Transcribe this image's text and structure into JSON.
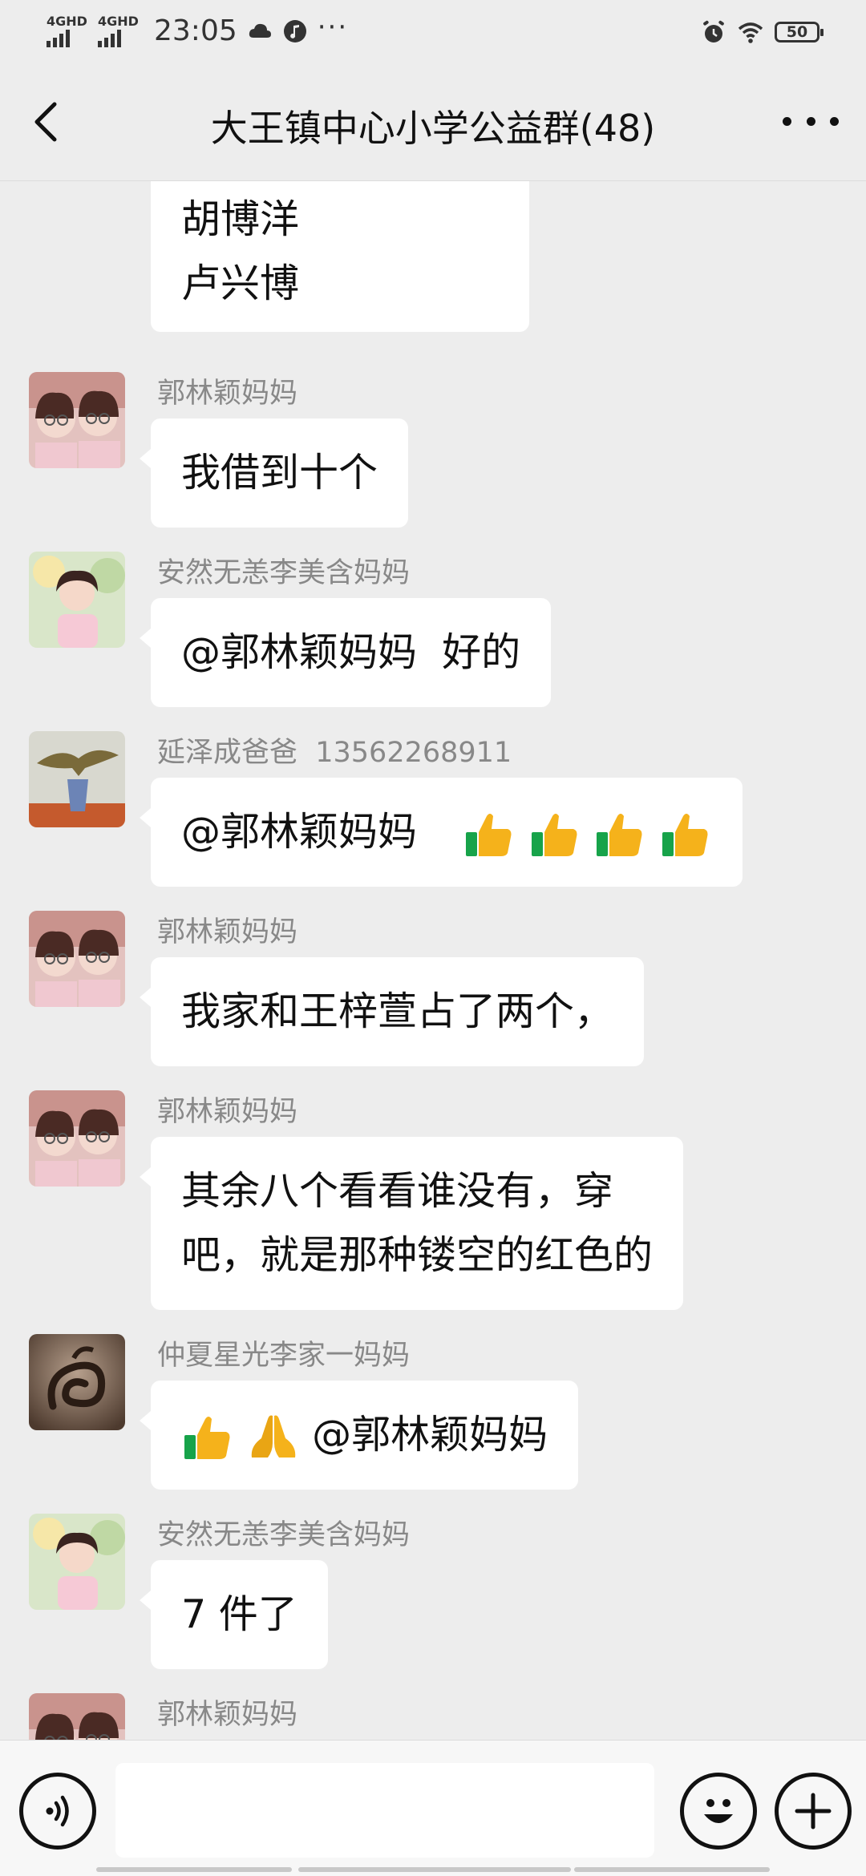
{
  "status_bar": {
    "network1": "4GHD",
    "network2": "4GHD",
    "time": "23:05",
    "more": "···",
    "battery": "50"
  },
  "header": {
    "title": "大王镇中心小学公益群(48)"
  },
  "messages": [
    {
      "sender": "",
      "lines": [
        "胡博洋",
        "卢兴博"
      ]
    },
    {
      "sender": "郭林颖妈妈",
      "text": "我借到十个"
    },
    {
      "sender": "安然无恙李美含妈妈",
      "text": "@郭林颖妈妈  好的"
    },
    {
      "sender": "延泽成爸爸  13562268911",
      "text": "@郭林颖妈妈"
    },
    {
      "sender": "郭林颖妈妈",
      "text": "我家和王梓萱占了两个，"
    },
    {
      "sender": "郭林颖妈妈",
      "lines": [
        "其余八个看看谁没有，穿",
        "吧，就是那种镂空的红色的"
      ]
    },
    {
      "sender": "仲夏星光李家一妈妈",
      "text": "@郭林颖妈妈"
    },
    {
      "sender": "安然无恙李美含妈妈",
      "text": "7 件了"
    },
    {
      "sender": "郭林颖妈妈"
    }
  ],
  "input": {
    "placeholder": ""
  },
  "colors": {
    "background": "#ededed",
    "bubble": "#ffffff",
    "sender": "#888888"
  }
}
